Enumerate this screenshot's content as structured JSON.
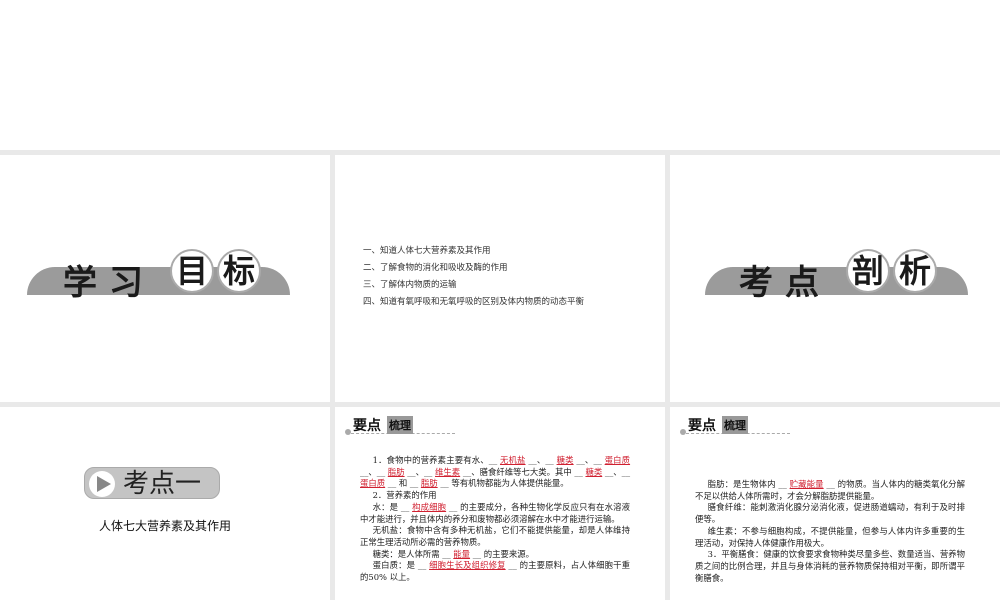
{
  "slide1": {
    "title_chars": [
      "学",
      "习",
      "目",
      "标"
    ]
  },
  "slide2": {
    "goals": [
      "一、知道人体七大营养素及其作用",
      "二、了解食物的消化和吸收及酶的作用",
      "三、了解体内物质的运输",
      "四、知道有氧呼吸和无氧呼吸的区别及体内物质的动态平衡"
    ]
  },
  "slide3": {
    "title_chars": [
      "考",
      "点",
      "剖",
      "析"
    ]
  },
  "slide4": {
    "badge": "考点一",
    "subtitle": "人体七大营养素及其作用"
  },
  "section_header": {
    "part1": "要点",
    "part2": "梳理"
  },
  "slide5": {
    "paragraphs": [
      [
        {
          "t": "1．食物中的营养素主要有水、__ "
        },
        {
          "a": "无机盐"
        },
        {
          "t": " __、__ "
        },
        {
          "a": "糖类"
        },
        {
          "t": " __、__ "
        },
        {
          "a": "蛋白质"
        },
        {
          "t": " __、__ "
        },
        {
          "a": "脂肪"
        },
        {
          "t": " __、__ "
        },
        {
          "a": "维生素"
        },
        {
          "t": " __、膳食纤维等七大类。其中 __ "
        },
        {
          "a": "糖类"
        },
        {
          "t": " __、__ "
        },
        {
          "a": "蛋白质"
        },
        {
          "t": " __ 和 __ "
        },
        {
          "a": "脂肪"
        },
        {
          "t": " __ 等有机物都能为人体提供能量。"
        }
      ],
      [
        {
          "t": "2．营养素的作用"
        }
      ],
      [
        {
          "t": "水：是 __ "
        },
        {
          "a": "构成细胞"
        },
        {
          "t": " __ 的主要成分，各种生物化学反应只有在水溶液中才能进行，并且体内的养分和废物都必须溶解在水中才能进行运输。"
        }
      ],
      [
        {
          "t": "无机盐：食物中含有多种无机盐，它们不能提供能量，却是人体维持正常生理活动所必需的营养物质。"
        }
      ],
      [
        {
          "t": "糖类：是人体所需 __ "
        },
        {
          "a": "能量"
        },
        {
          "t": " __ 的主要来源。"
        }
      ],
      [
        {
          "t": "蛋白质：是 __ "
        },
        {
          "a": "细胞生长及组织修复"
        },
        {
          "t": " __ 的主要原料，占人体细胞干重的50% 以上。"
        }
      ]
    ]
  },
  "slide6": {
    "paragraphs": [
      [
        {
          "t": "脂肪：是生物体内 __ "
        },
        {
          "a": "贮藏能量"
        },
        {
          "t": " __ 的物质。当人体内的糖类氧化分解不足以供给人体所需时，才会分解脂肪提供能量。"
        }
      ],
      [
        {
          "t": "膳食纤维：能刺激消化腺分泌消化液，促进肠道蠕动，有利于及时排便等。"
        }
      ],
      [
        {
          "t": "维生素：不参与细胞构成，不提供能量，但参与人体内许多重要的生理活动，对保持人体健康作用极大。"
        }
      ],
      [
        {
          "t": "3．平衡膳食：健康的饮食要求食物种类尽量多些、数量适当、营养物质之间的比例合理，并且与身体消耗的营养物质保持相对平衡，即所谓平衡膳食。"
        }
      ]
    ]
  }
}
